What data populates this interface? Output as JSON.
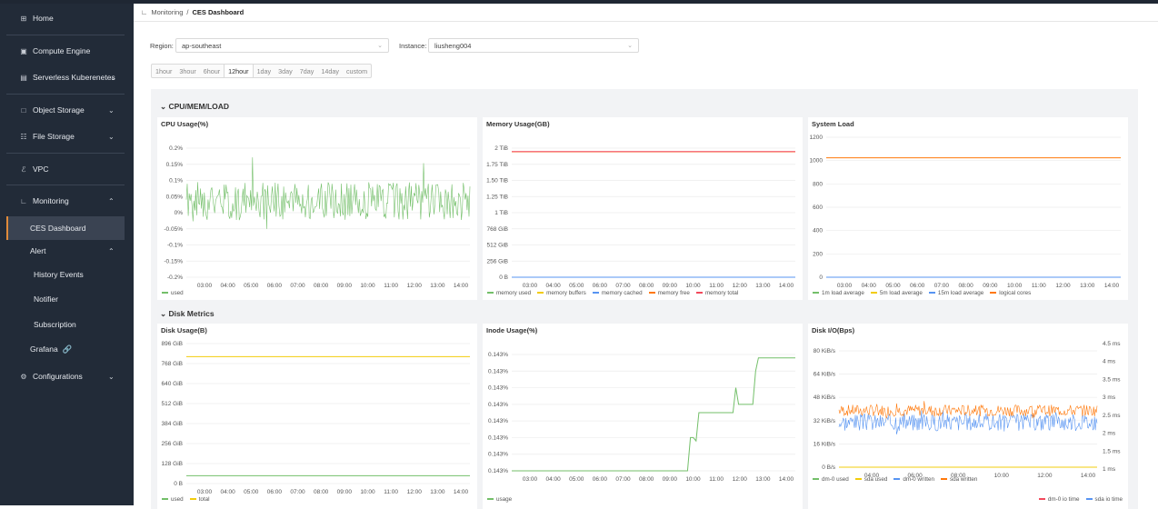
{
  "sidebar": {
    "items": [
      {
        "label": "Home",
        "icon": "grid-icon"
      },
      {
        "label": "Compute Engine",
        "icon": "chip-icon"
      },
      {
        "label": "Serverless Kuberenetes",
        "icon": "box-icon"
      },
      {
        "label": "Object Storage",
        "icon": "square-icon"
      },
      {
        "label": "File Storage",
        "icon": "folder-icon"
      },
      {
        "label": "VPC",
        "icon": "network-icon"
      },
      {
        "label": "Monitoring",
        "icon": "chart-icon"
      },
      {
        "label": "CES Dashboard"
      },
      {
        "label": "Alert"
      },
      {
        "label": "History Events"
      },
      {
        "label": "Notifier"
      },
      {
        "label": "Subscription"
      },
      {
        "label": "Grafana",
        "icon": "link-icon"
      },
      {
        "label": "Configurations",
        "icon": "gear-icon"
      }
    ]
  },
  "breadcrumb": {
    "parent": "Monitoring",
    "sep": "/",
    "current": "CES Dashboard"
  },
  "filters": {
    "region_label": "Region:",
    "region_value": "ap-southeast",
    "instance_label": "Instance:",
    "instance_value": "liusheng004"
  },
  "ranges": [
    "1hour",
    "3hour",
    "6hour",
    "12hour",
    "1day",
    "3day",
    "7day",
    "14day",
    "custom"
  ],
  "selected_range": "12hour",
  "sections": {
    "cpu": "CPU/MEM/LOAD",
    "disk": "Disk Metrics"
  },
  "colors": {
    "green": "#73bf69",
    "yellow": "#f2cc0c",
    "blue": "#5794f2",
    "orange": "#ff780a",
    "red": "#f2495c",
    "accent": "#e08a3a"
  },
  "chart_data": [
    {
      "type": "line",
      "title": "CPU Usage(%)",
      "x": [
        "03:00",
        "04:00",
        "05:00",
        "06:00",
        "07:00",
        "08:00",
        "09:00",
        "10:00",
        "11:00",
        "12:00",
        "13:00",
        "14:00"
      ],
      "yticks": [
        "0.2%",
        "0.15%",
        "0.1%",
        "0.05%",
        "0%",
        "-0.05%",
        "-0.1%",
        "-0.15%",
        "-0.2%"
      ],
      "ylim": [
        -0.2,
        0.2
      ],
      "series": [
        {
          "name": "used",
          "color": "#73bf69",
          "pattern": "noise",
          "base": 0.035,
          "amp": 0.06,
          "seed": 1
        }
      ]
    },
    {
      "type": "line",
      "title": "Memory Usage(GB)",
      "x": [
        "03:00",
        "04:00",
        "05:00",
        "06:00",
        "07:00",
        "08:00",
        "09:00",
        "10:00",
        "11:00",
        "12:00",
        "13:00",
        "14:00"
      ],
      "yticks": [
        "2 TiB",
        "1.75 TiB",
        "1.50 TiB",
        "1.25 TiB",
        "1 TiB",
        "768 GiB",
        "512 GiB",
        "256 GiB",
        "0 B"
      ],
      "ylim": [
        0,
        2048
      ],
      "series": [
        {
          "name": "memory used",
          "color": "#73bf69",
          "pattern": "flat",
          "base": 0
        },
        {
          "name": "memory buffers",
          "color": "#f2cc0c",
          "pattern": "flat",
          "base": 0
        },
        {
          "name": "memory cached",
          "color": "#5794f2",
          "pattern": "flat",
          "base": 0
        },
        {
          "name": "memory free",
          "color": "#ff780a",
          "pattern": "flat",
          "base": 1990
        },
        {
          "name": "memory total",
          "color": "#f2495c",
          "pattern": "flat",
          "base": 1993
        }
      ]
    },
    {
      "type": "line",
      "title": "System Load",
      "x": [
        "03:00",
        "04:00",
        "05:00",
        "06:00",
        "07:00",
        "08:00",
        "09:00",
        "10:00",
        "11:00",
        "12:00",
        "13:00",
        "14:00"
      ],
      "yticks": [
        "1200",
        "1000",
        "800",
        "600",
        "400",
        "200",
        "0"
      ],
      "ylim": [
        0,
        1200
      ],
      "series": [
        {
          "name": "1m load average",
          "color": "#73bf69",
          "pattern": "flat",
          "base": 0
        },
        {
          "name": "5m load average",
          "color": "#f2cc0c",
          "pattern": "flat",
          "base": 0
        },
        {
          "name": "15m load average",
          "color": "#5794f2",
          "pattern": "flat",
          "base": 0
        },
        {
          "name": "logical cores",
          "color": "#ff780a",
          "pattern": "flat",
          "base": 1024
        }
      ]
    },
    {
      "type": "line",
      "title": "Disk Usage(B)",
      "x": [
        "03:00",
        "04:00",
        "05:00",
        "06:00",
        "07:00",
        "08:00",
        "09:00",
        "10:00",
        "11:00",
        "12:00",
        "13:00",
        "14:00"
      ],
      "yticks": [
        "896 GiB",
        "768 GiB",
        "640 GiB",
        "512 GiB",
        "384 GiB",
        "256 GiB",
        "128 GiB",
        "0 B"
      ],
      "ylim": [
        0,
        896
      ],
      "series": [
        {
          "name": "used",
          "color": "#73bf69",
          "pattern": "flat",
          "base": 50
        },
        {
          "name": "total",
          "color": "#f2cc0c",
          "pattern": "flat",
          "base": 812
        }
      ]
    },
    {
      "type": "line",
      "title": "Inode Usage(%)",
      "x": [
        "03:00",
        "04:00",
        "05:00",
        "06:00",
        "07:00",
        "08:00",
        "09:00",
        "10:00",
        "11:00",
        "12:00",
        "13:00",
        "14:00"
      ],
      "yticks": [
        "0.143%",
        "0.143%",
        "0.143%",
        "0.143%",
        "0.143%",
        "0.143%",
        "0.143%",
        "0.143%"
      ],
      "ylim": [
        0,
        7
      ],
      "series": [
        {
          "name": "usage",
          "color": "#73bf69",
          "pattern": "steps",
          "steps": [
            [
              0,
              0
            ],
            [
              0.62,
              0
            ],
            [
              0.63,
              2
            ],
            [
              0.64,
              2
            ],
            [
              0.65,
              1.8
            ],
            [
              0.66,
              3.5
            ],
            [
              0.78,
              3.5
            ],
            [
              0.79,
              5
            ],
            [
              0.8,
              4
            ],
            [
              0.85,
              4
            ],
            [
              0.86,
              6
            ],
            [
              0.87,
              6.8
            ],
            [
              1,
              6.8
            ]
          ]
        }
      ]
    },
    {
      "type": "line",
      "title": "Disk I/O(Bps)",
      "x": [
        "04:00",
        "06:00",
        "08:00",
        "10:00",
        "12:00",
        "14:00"
      ],
      "yticks": [
        "80 KiB/s",
        "64 KiB/s",
        "48 KiB/s",
        "32 KiB/s",
        "16 KiB/s",
        "0 B/s"
      ],
      "ylim": [
        0,
        80
      ],
      "y2ticks": [
        "4.5 ms",
        "4 ms",
        "3.5 ms",
        "3 ms",
        "2.5 ms",
        "2 ms",
        "1.5 ms",
        "1 ms"
      ],
      "series": [
        {
          "name": "dm-0 used",
          "color": "#73bf69",
          "pattern": "flat",
          "base": 0
        },
        {
          "name": "sda used",
          "color": "#f2cc0c",
          "pattern": "flat",
          "base": 0
        },
        {
          "name": "dm-0 written",
          "color": "#5794f2",
          "pattern": "noise",
          "base": 31,
          "amp": 6,
          "seed": 3
        },
        {
          "name": "sda written",
          "color": "#ff780a",
          "pattern": "noise",
          "base": 39,
          "amp": 4,
          "seed": 7
        }
      ],
      "legend2": [
        {
          "name": "dm-0 io time",
          "color": "#f2495c"
        },
        {
          "name": "sda io time",
          "color": "#5794f2"
        }
      ]
    }
  ]
}
